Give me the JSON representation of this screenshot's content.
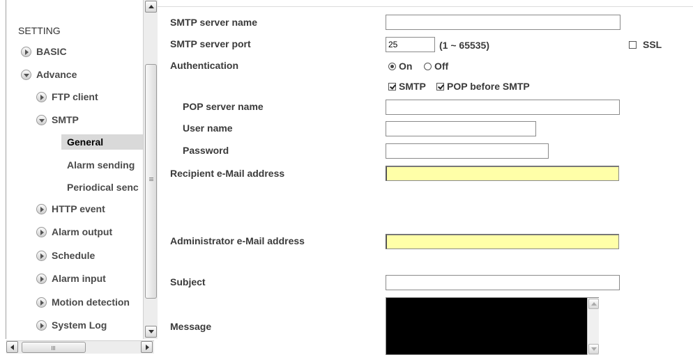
{
  "sidebar": {
    "root": "SETTING",
    "items": [
      {
        "label": "BASIC",
        "state": "collapsed"
      },
      {
        "label": "Advance",
        "state": "expanded"
      },
      {
        "label": "FTP client",
        "state": "collapsed"
      },
      {
        "label": "SMTP",
        "state": "expanded"
      },
      {
        "label": "General",
        "state": "selected"
      },
      {
        "label": "Alarm sending"
      },
      {
        "label": "Periodical senc"
      },
      {
        "label": "HTTP event",
        "state": "collapsed"
      },
      {
        "label": "Alarm output",
        "state": "collapsed"
      },
      {
        "label": "Schedule",
        "state": "collapsed"
      },
      {
        "label": "Alarm input",
        "state": "collapsed"
      },
      {
        "label": "Motion detection",
        "state": "collapsed"
      },
      {
        "label": "System Log",
        "state": "collapsed"
      }
    ],
    "hscroll_grip": "III"
  },
  "form": {
    "smtp_server_name_label": "SMTP server name",
    "smtp_server_name_value": "",
    "smtp_server_port_label": "SMTP server port",
    "smtp_server_port_value": "25",
    "smtp_server_port_range": "(1 ~ 65535)",
    "ssl_label": "SSL",
    "ssl_checked": false,
    "authentication_label": "Authentication",
    "auth_on_label": "On",
    "auth_off_label": "Off",
    "auth_selected": "On",
    "smtp_check_label": "SMTP",
    "pop_before_smtp_label": "POP before SMTP",
    "pop_server_name_label": "POP server name",
    "pop_server_name_value": "",
    "user_name_label": "User name",
    "user_name_value": "",
    "password_label": "Password",
    "password_value": "",
    "recipient_label": "Recipient e-Mail address",
    "recipient_value": "",
    "admin_label": "Administrator e-Mail address",
    "admin_value": "",
    "subject_label": "Subject",
    "subject_value": "",
    "message_label": "Message"
  },
  "colors": {
    "required_field_bg": "#ffffa8",
    "message_bg": "#000000",
    "selected_item_bg": "#d9d9d9"
  }
}
